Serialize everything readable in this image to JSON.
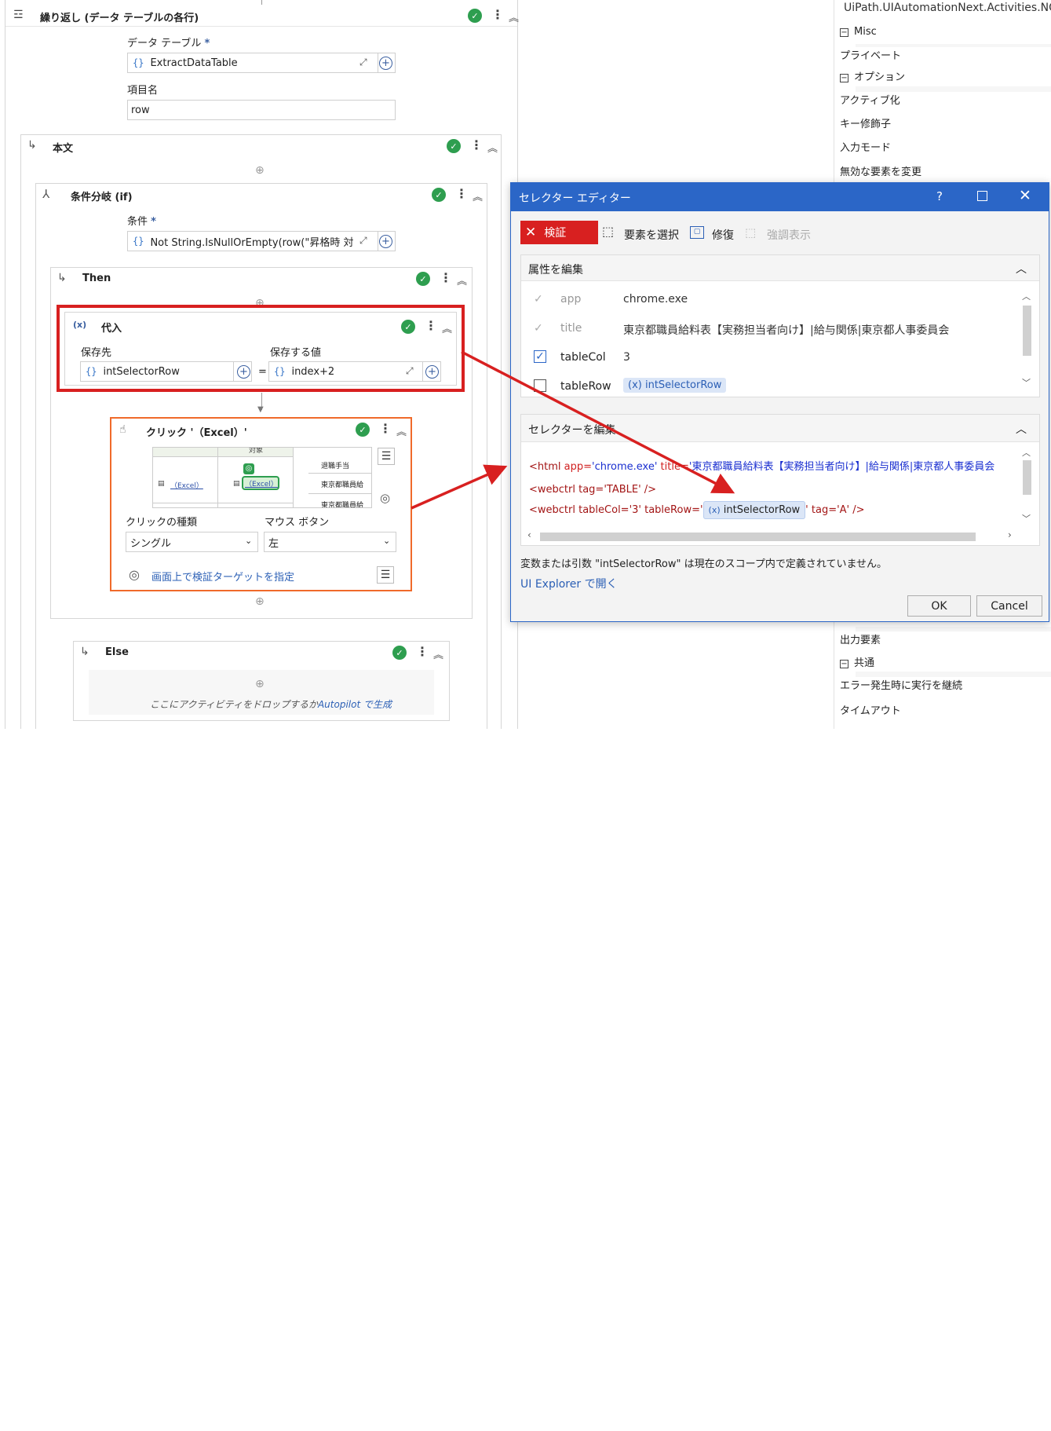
{
  "foreach": {
    "title": "繰り返し (データ テーブルの各行)",
    "datatable_label": "データ テーブル",
    "required": "*",
    "datatable_value": "ExtractDataTable",
    "item_label": "項目名",
    "item_value": "row"
  },
  "body": {
    "title": "本文"
  },
  "if": {
    "title": "条件分岐 (if)",
    "condition_label": "条件",
    "condition_value": "Not String.IsNullOrEmpty(row(\"昇格時 対ㇵ"
  },
  "then": {
    "title": "Then"
  },
  "assign": {
    "title": "代入",
    "to_label": "保存先",
    "to_value": "intSelectorRow",
    "value_label": "保存する値",
    "value_value": "index+2",
    "equals": "=",
    "icon": "(x)"
  },
  "click": {
    "title": "クリック '（Excel）'",
    "type_label": "クリックの種類",
    "type_value": "シングル",
    "mouse_label": "マウス ボタン",
    "mouse_value": "左",
    "verify_link": "画面上で検証ターゲットを指定",
    "preview": {
      "top_text": "対象",
      "link1": "（Excel）",
      "link2": "（Excel）",
      "cell1": "退職手当",
      "cell2": "東京都職員給",
      "cell3": "東京都職員給"
    }
  },
  "else": {
    "title": "Else",
    "placeholder": "ここにアクティビティをドロップするか",
    "autopilot": "Autopilot で生成"
  },
  "sidebar": {
    "top_text": "UiPath.UIAutomationNext.Activities.NCli",
    "cat_misc": "Misc",
    "item_private": "プライベート",
    "cat_options": "オプション",
    "item_activate": "アクティブ化",
    "item_modifier": "キー修飾子",
    "item_inputmode": "入力モード",
    "item_invalid": "無効な要素を変更",
    "item_output": "出力要素",
    "cat_common": "共通",
    "item_continue": "エラー発生時に実行を継続",
    "item_timeout": "タイムアウト"
  },
  "dialog": {
    "title": "セレクター エディター",
    "help": "?",
    "validate": "検証",
    "select": "要素を選択",
    "repair": "修復",
    "highlight": "強調表示",
    "attr_header": "属性を編集",
    "attrs": [
      {
        "name": "app",
        "value": "chrome.exe"
      },
      {
        "name": "title",
        "value": "東京都職員給料表【実務担当者向け】|給与関係|東京都人事委員会"
      },
      {
        "name": "tableCol",
        "value": "3"
      },
      {
        "name": "tableRow",
        "value": "intSelectorRow"
      }
    ],
    "selector_header": "セレクターを編集",
    "line1_tag": "<html",
    "line1_app_attr": " app=",
    "line1_app_val": "'chrome.exe'",
    "line1_title_attr": " title=",
    "line1_title_val": "'東京都職員給料表【実務担当者向け】|給与関係|東京都人事委員会",
    "line2": "<webctrl tag='TABLE' />",
    "line3_pre": "<webctrl tableCol='3' tableRow='",
    "line3_var": "intSelectorRow",
    "line3_post": "' tag='A' />",
    "var_icon": "(x)",
    "message": "変数または引数 \"intSelectorRow\" は現在のスコープ内で定義されていません。",
    "explorer_link": "UI Explorer で開く",
    "ok": "OK",
    "cancel": "Cancel"
  },
  "colors": {
    "accent": "#2b66c7",
    "success": "#2e9e4f",
    "error": "#d82020",
    "highlight_orange": "#f06a2a"
  }
}
